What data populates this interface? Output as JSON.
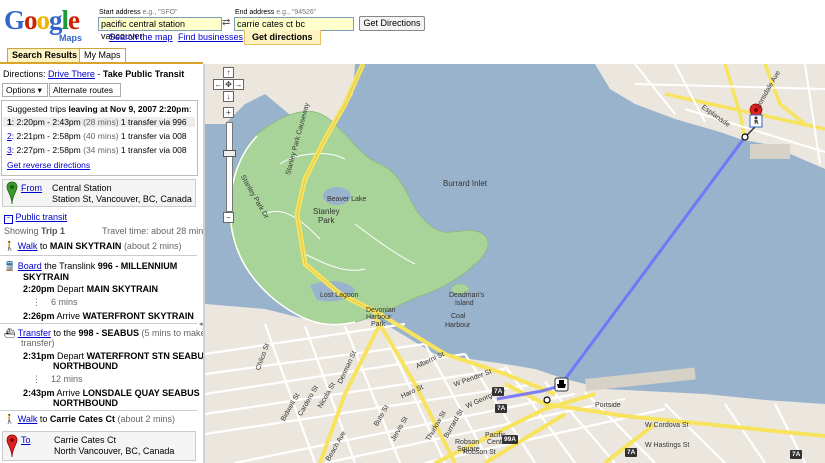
{
  "header": {
    "logo_text": "Google",
    "logo_sub": "Maps",
    "start_label": "Start address",
    "start_example": "e.g., \"SFO\"",
    "start_value": "pacific central station vancouver",
    "end_label": "End address",
    "end_example": "e.g., \"94526\"",
    "end_value": "carrie cates ct bc",
    "swap_glyph": "⇄",
    "get_directions_button": "Get Directions",
    "tabs": [
      "Search the map",
      "Find businesses",
      "Get directions"
    ]
  },
  "panel_tabs": [
    "Search Results",
    "My Maps"
  ],
  "directions": {
    "prefix": "Directions:",
    "drive_link": "Drive There",
    "sep": " - ",
    "mode": "Take Public Transit",
    "options_label": "Options",
    "alt_routes_label": "Alternate routes",
    "suggested_prefix": "Suggested trips",
    "suggested_bold": "leaving at Nov 9, 2007 2:20pm",
    "suggested_colon": ":",
    "trips": [
      {
        "num": "1",
        "times": "2:20pm - 2:43pm",
        "dur": "(28 mins)",
        "desc": "1 transfer via 996"
      },
      {
        "num": "2",
        "times": "2:21pm - 2:58pm",
        "dur": "(40 mins)",
        "desc": "1 transfer via 008"
      },
      {
        "num": "3",
        "times": "2:27pm - 2:58pm",
        "dur": "(34 mins)",
        "desc": "1 transfer via 008"
      }
    ],
    "reverse_link": "Get reverse directions",
    "from_label": "From",
    "from_name": "Central Station",
    "from_addr": "Station St, Vancouver, BC, Canada",
    "public_transit_link": "Public transit",
    "showing_trip": "Showing",
    "showing_trip_bold": "Trip 1",
    "travel_time": "Travel time: about 28 mins",
    "walk1_link": "Walk",
    "walk1_to": " to ",
    "walk1_dest": "MAIN SKYTRAIN",
    "walk1_dur": "(about 2 mins)",
    "board_link": "Board",
    "board_text": " the Translink ",
    "board_route": "996 - MILLENNIUM",
    "board_route2": "SKYTRAIN",
    "dep1_time": "2:20pm",
    "dep1_word": "Depart",
    "dep1_stop": "MAIN SKYTRAIN",
    "ride1_mins": "6 mins",
    "arr1_time": "2:26pm",
    "arr1_word": "Arrive",
    "arr1_stop": "WATERFRONT SKYTRAIN",
    "transfer_link": "Transfer",
    "transfer_to": " to the ",
    "transfer_route": "998 - SEABUS",
    "transfer_note": "(5 mins to make",
    "transfer_note2": "transfer)",
    "dep2_time": "2:31pm",
    "dep2_word": "Depart",
    "dep2_stop": "WATERFRONT STN SEABUS",
    "dep2_stop2": "NORTHBOUND",
    "ride2_mins": "12 mins",
    "arr2_time": "2:43pm",
    "arr2_word": "Arrive",
    "arr2_stop": "LONSDALE QUAY SEABUS",
    "arr2_stop2": "NORTHBOUND",
    "walk2_link": "Walk",
    "walk2_to": " to ",
    "walk2_dest": "Carrie Cates Ct",
    "walk2_dur": "(about 2 mins)",
    "to_label": "To",
    "to_name": "Carrie Cates Ct",
    "to_addr": "North Vancouver, BC, Canada"
  },
  "map": {
    "labels": {
      "burrard_inlet": "Burrard Inlet",
      "stanley_park": "Stanley",
      "stanley_park2": "Park",
      "beaver_lake": "Beaver Lake",
      "lost_lagoon": "Lost Lagoon",
      "deadmans": "Deadman's",
      "deadmans2": "Island",
      "coal": "Coal",
      "harbour": "Harbour",
      "devonian": "Devonian",
      "devonian2": "Harbour",
      "devonian3": "Park",
      "stanley_causeway": "Stanley Park Causeway",
      "stanley_dr": "Stanley Park Dr",
      "denman": "Denman St",
      "pender": "W Pender St",
      "georgia": "W Georgia St",
      "hastings": "W Hastings St",
      "robson": "Robson St",
      "burrard": "Burrard St",
      "thurlow": "Thurlow St",
      "bute": "Bute St",
      "jervis": "Jervis St",
      "nicola": "Nicola St",
      "cardero": "Cardero St",
      "bidwell": "Bidwell St",
      "beach": "Beach Ave",
      "pacific_centre": "Pacific",
      "pacific_centre2": "Centre",
      "robson_square": "Robson",
      "robson_square2": "Square",
      "portside": "Portside",
      "esplanade": "Esplanade",
      "lonsdale": "Lonsdale Ave",
      "cordova": "W Cordova St",
      "chilco": "Chilco St",
      "alberni": "Alberni St",
      "haro": "Haro St"
    },
    "highway_shields": [
      "7A",
      "7A",
      "99A",
      "7A",
      "7A"
    ],
    "colors": {
      "water": "#99b3cc",
      "park": "#a8d49a",
      "land": "#ebe7df",
      "route": "#6b6bff",
      "major_road": "#f7e35e"
    }
  }
}
